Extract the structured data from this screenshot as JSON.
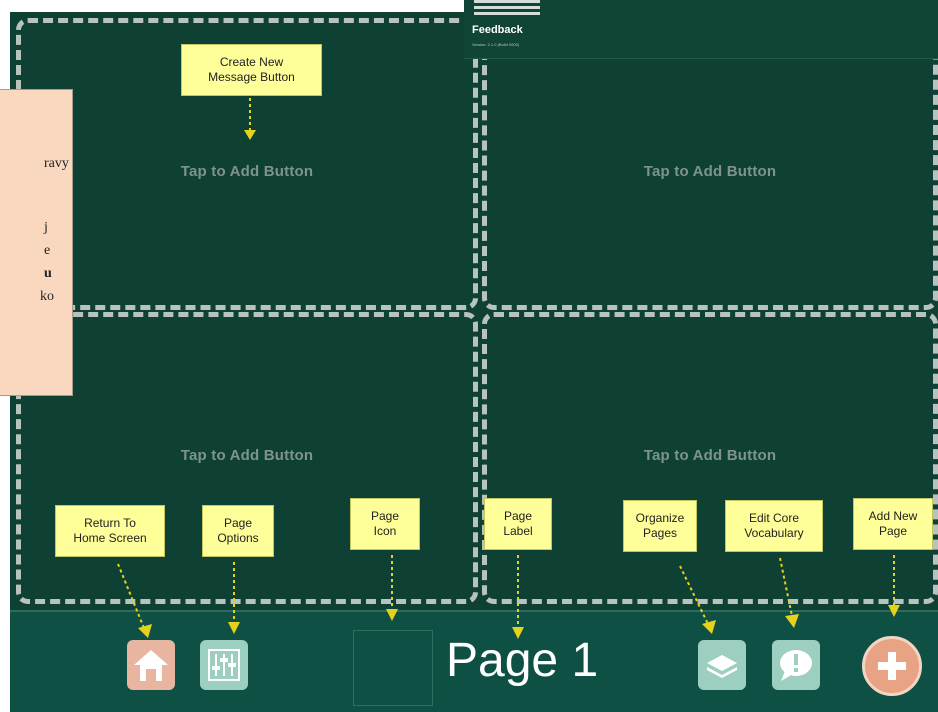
{
  "tiles": [
    {
      "label": "Tap to Add Button"
    },
    {
      "label": "Tap to Add Button"
    },
    {
      "label": "Tap to Add Button"
    },
    {
      "label": "Tap to Add Button"
    }
  ],
  "feedback": {
    "title": "Feedback",
    "version": "Version: 2.1.0 (Build 0000)"
  },
  "toolbar": {
    "page_label": "Page 1"
  },
  "callouts": {
    "create_message": "Create New\nMessage Button",
    "return_home": "Return To\nHome Screen",
    "page_options": "Page\nOptions",
    "page_icon": "Page\nIcon",
    "page_label": "Page\nLabel",
    "organize_pages": "Organize\nPages",
    "edit_core": "Edit Core\nVocabulary",
    "add_new_page": "Add New\nPage"
  },
  "side_panel": {
    "fragments": [
      "ravy",
      "j",
      "e",
      "u",
      "ko"
    ]
  },
  "colors": {
    "background": "#0f4034",
    "callout": "#ffff99",
    "arrow": "#e6d21c",
    "home_button": "#e8b5a1",
    "toolbar_button": "#9dcfc1",
    "add_button": "#e7a383"
  },
  "icons": [
    "home-icon",
    "sliders-icon",
    "stack-icon",
    "speech-bubble-exclamation-icon",
    "plus-icon"
  ]
}
